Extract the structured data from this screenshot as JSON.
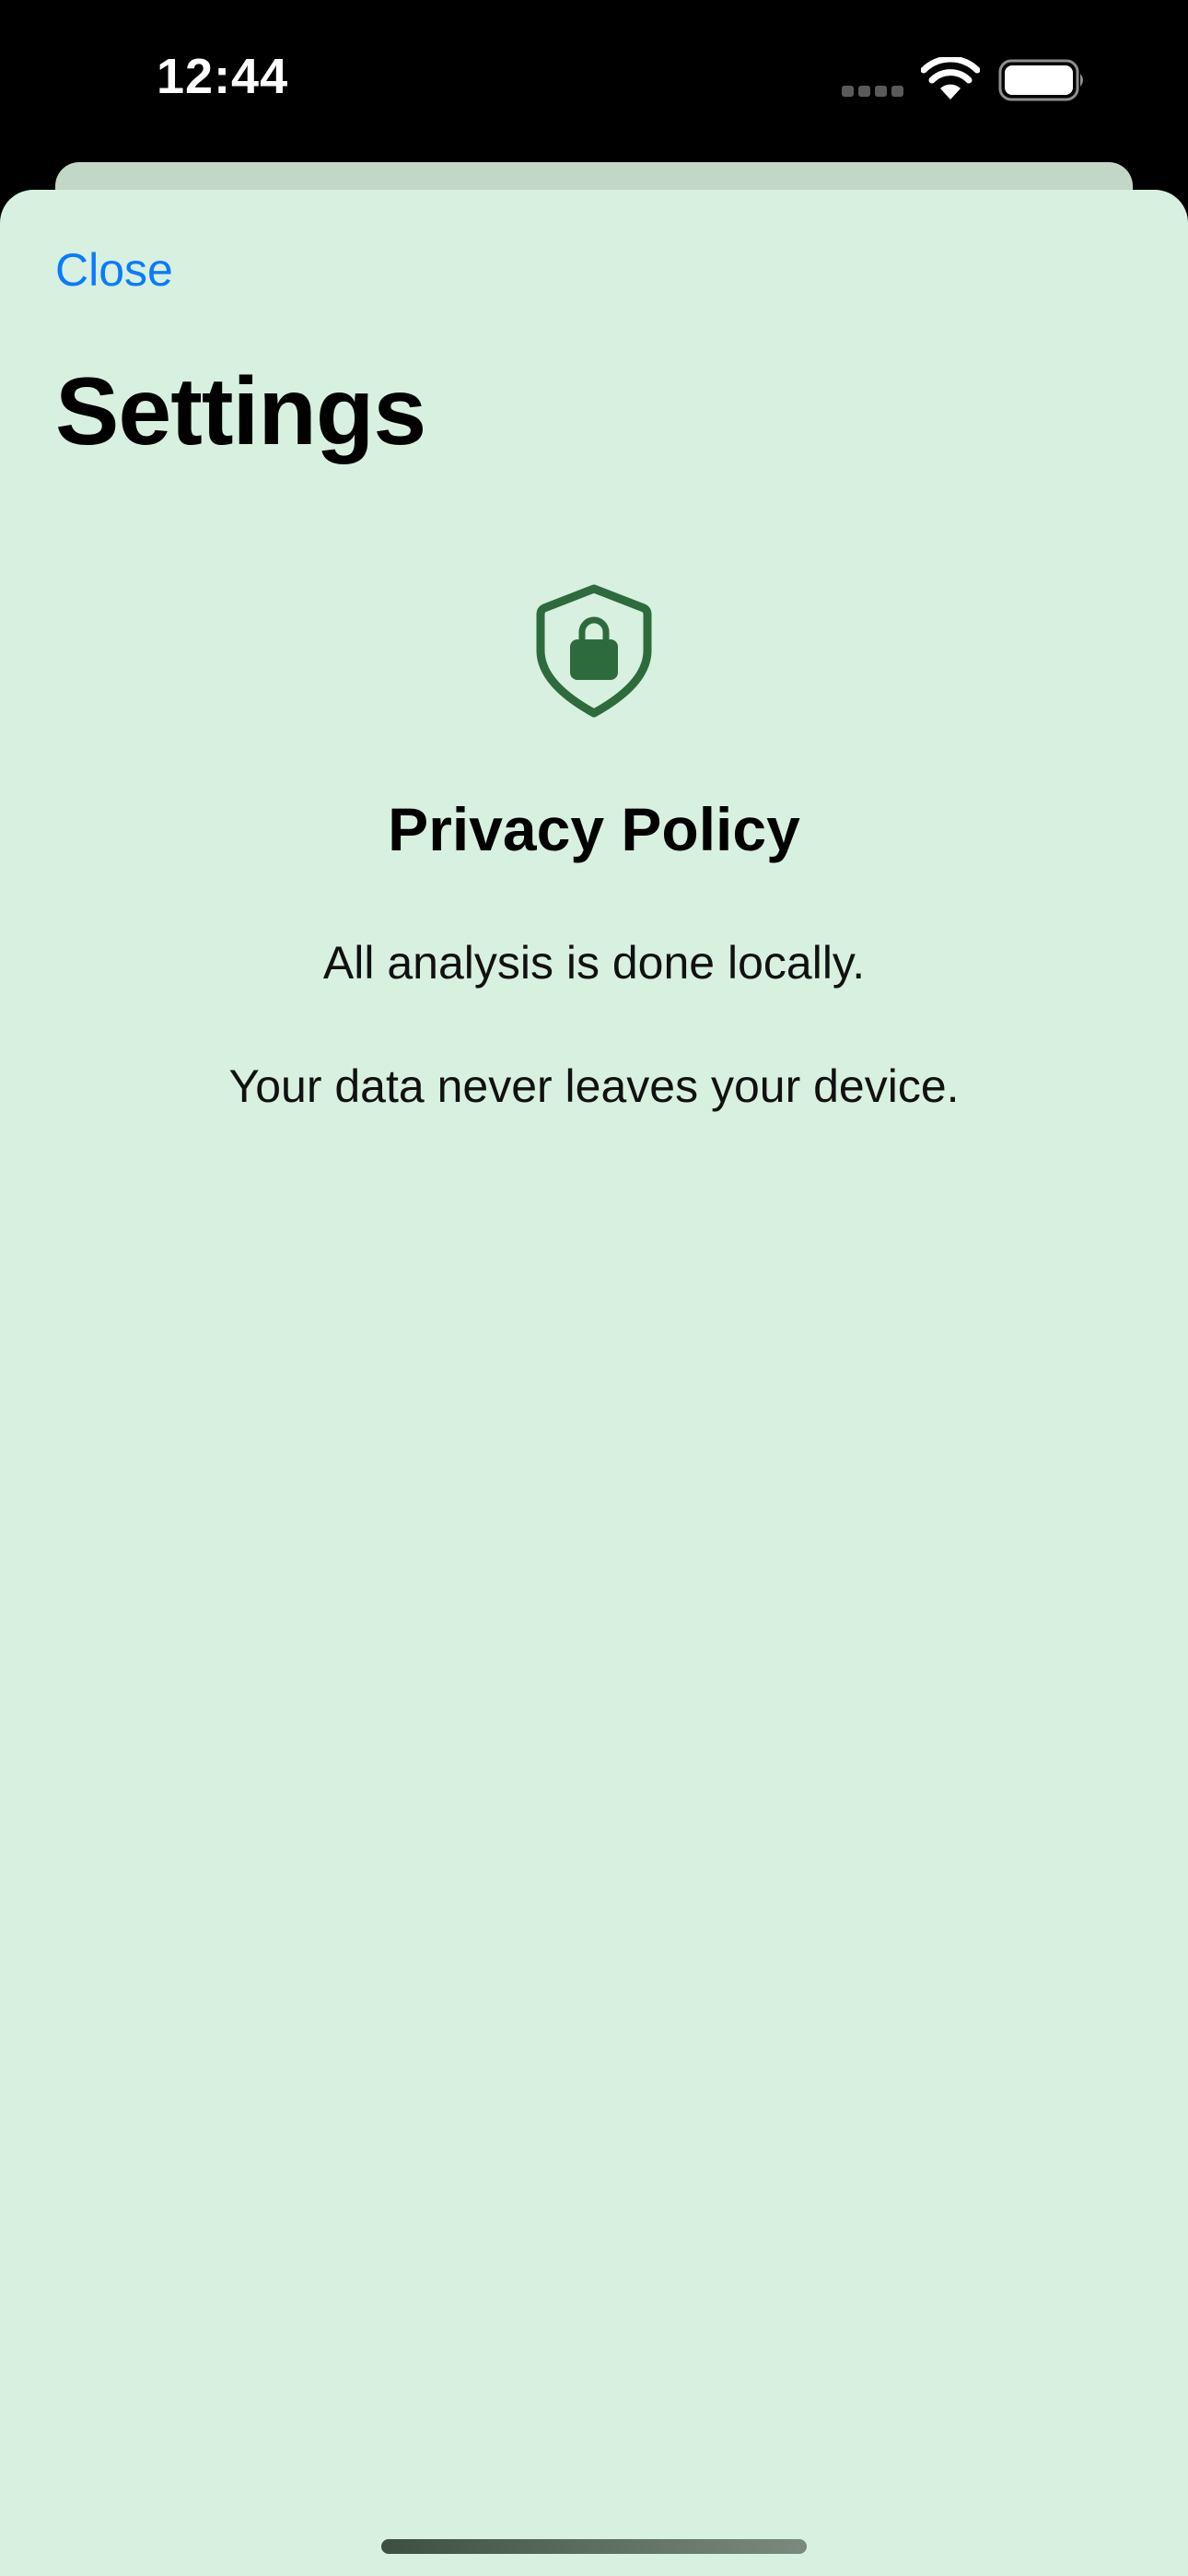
{
  "status_bar": {
    "time": "12:44",
    "icons": [
      "cellular-signal-icon",
      "wifi-icon",
      "battery-icon"
    ]
  },
  "sheet": {
    "close_label": "Close",
    "title": "Settings",
    "background_color": "#d8f0e0",
    "accent_color": "#0a7bff"
  },
  "privacy": {
    "icon": "shield-lock-icon",
    "icon_color": "#2e6b3c",
    "title": "Privacy Policy",
    "line_1": "All analysis is done locally.",
    "line_2": "Your data never leaves your device."
  }
}
